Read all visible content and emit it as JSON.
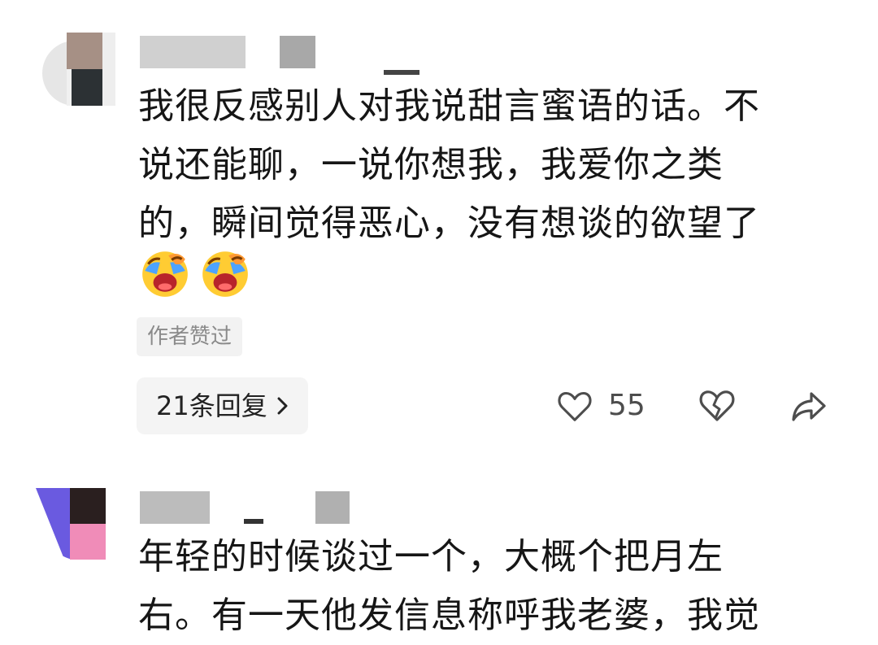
{
  "comments": [
    {
      "text": "我很反感别人对我说甜言蜜语的话。不\n说还能聊，一说你想我，我爱你之类\n的，瞬间觉得恶心，没有想谈的欲望了",
      "emoji_name": "laugh-cry-emoji",
      "author_badge": "作者赞过",
      "reply_label": "21条回复",
      "like_count": "55"
    },
    {
      "text": "年轻的时候谈过一个，大概个把月左\n右。有一天他发信息称呼我老婆，我觉"
    }
  ],
  "icons": {
    "like": "heart-outline-icon",
    "dislike": "broken-heart-icon",
    "share": "share-arrow-icon",
    "reply_chevron": "chevron-right-icon"
  },
  "colors": {
    "text": "#161616",
    "muted": "#8a8a8a",
    "action_icon": "#4d4d4d",
    "chip_bg": "#f4f4f4"
  }
}
